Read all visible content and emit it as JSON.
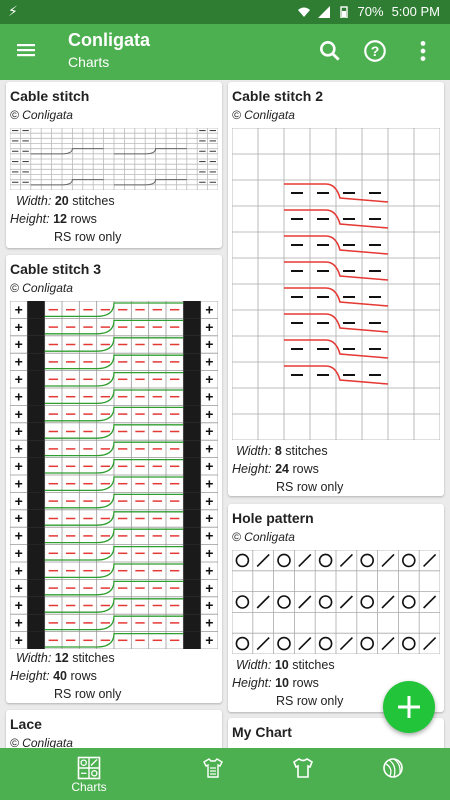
{
  "statusbar": {
    "battery": "70%",
    "time": "5:00 PM"
  },
  "appbar": {
    "title": "Conligata",
    "subtitle": "Charts"
  },
  "cards": [
    {
      "name": "Cable stitch",
      "author": "© Conligata",
      "width_label": "Width:",
      "width_value": "20",
      "width_unit": "stitches",
      "height_label": "Height:",
      "height_value": "12",
      "height_unit": "rows",
      "note": "RS row only"
    },
    {
      "name": "Cable stitch 2",
      "author": "© Conligata",
      "width_label": "Width:",
      "width_value": "8",
      "width_unit": "stitches",
      "height_label": "Height:",
      "height_value": "24",
      "height_unit": "rows",
      "note": "RS row only"
    },
    {
      "name": "Cable stitch 3",
      "author": "© Conligata",
      "width_label": "Width:",
      "width_value": "12",
      "width_unit": "stitches",
      "height_label": "Height:",
      "height_value": "40",
      "height_unit": "rows",
      "note": "RS row only"
    },
    {
      "name": "Hole pattern",
      "author": "© Conligata",
      "width_label": "Width:",
      "width_value": "10",
      "width_unit": "stitches",
      "height_label": "Height:",
      "height_value": "10",
      "height_unit": "rows",
      "note": "RS row only"
    },
    {
      "name": "Lace",
      "author": "© Conligata"
    },
    {
      "name": "My Chart"
    }
  ],
  "bottomnav": {
    "charts_label": "Charts"
  },
  "colors": {
    "primary": "#4caf50",
    "statusbar": "#2e7d32",
    "fab": "#22c53a",
    "cable_red": "#e53935",
    "cable_green": "#2e9e2e"
  }
}
